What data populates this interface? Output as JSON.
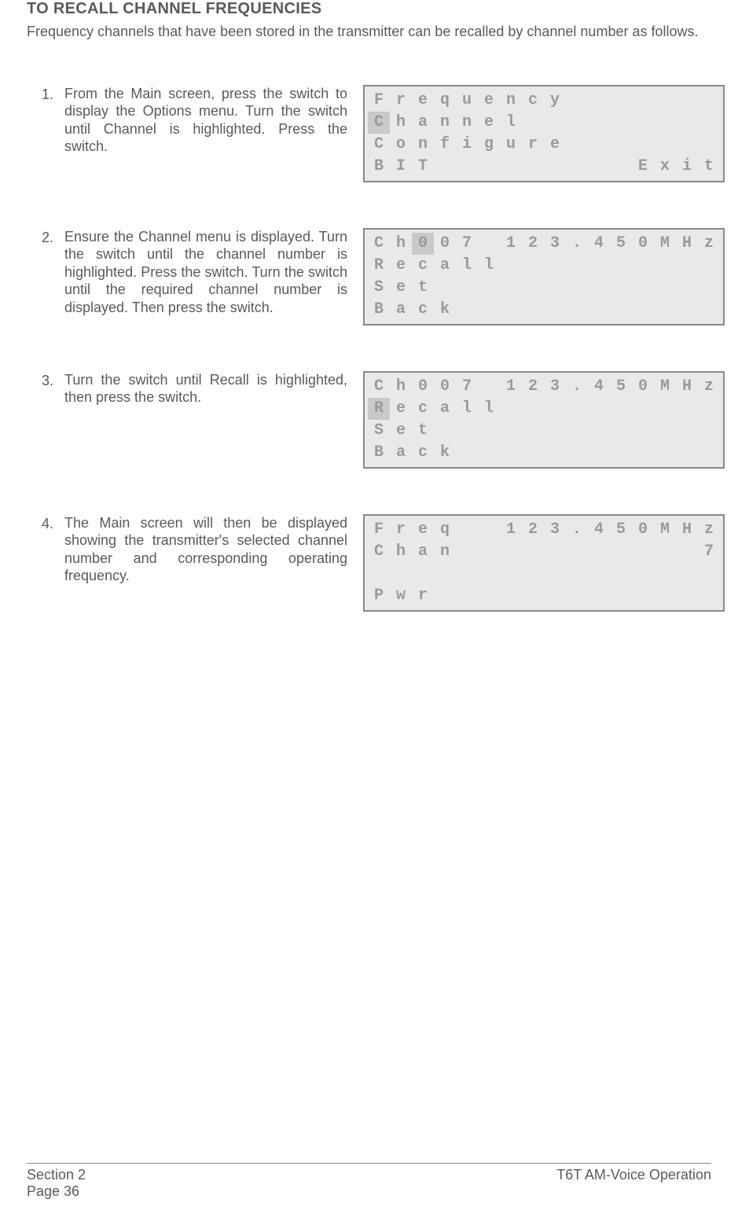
{
  "title": "TO RECALL CHANNEL FREQUENCIES",
  "intro": "Frequency channels that have been stored in the transmitter can be recalled by channel number as follows.",
  "steps": [
    {
      "num": "1.",
      "text": "From the Main screen, press the switch to display the Options menu. Turn the switch until Channel is highlighted. Press the switch.",
      "lcd": [
        {
          "cells": [
            "F",
            "r",
            "e",
            "q",
            "u",
            "e",
            "n",
            "c",
            "y",
            "",
            "",
            "",
            "",
            "",
            "",
            ""
          ],
          "hl": []
        },
        {
          "cells": [
            "C",
            "h",
            "a",
            "n",
            "n",
            "e",
            "l",
            "",
            "",
            "",
            "",
            "",
            "",
            "",
            "",
            ""
          ],
          "hl": [
            0
          ]
        },
        {
          "cells": [
            "C",
            "o",
            "n",
            "f",
            "i",
            "g",
            "u",
            "r",
            "e",
            "",
            "",
            "",
            "",
            "",
            "",
            ""
          ],
          "hl": []
        },
        {
          "cells": [
            "B",
            "I",
            "T",
            "",
            "",
            "",
            "",
            "",
            "",
            "",
            "",
            "",
            "E",
            "x",
            "i",
            "t"
          ],
          "hl": []
        }
      ]
    },
    {
      "num": "2.",
      "text": "Ensure the Channel menu is displayed. Turn the switch until the channel number is highlighted. Press the switch. Turn the switch until the required channel number is displayed. Then press the switch.",
      "lcd": [
        {
          "cells": [
            "C",
            "h",
            "0",
            "0",
            "7",
            "",
            "1",
            "2",
            "3",
            ".",
            "4",
            "5",
            "0",
            "M",
            "H",
            "z"
          ],
          "hl": [
            2
          ]
        },
        {
          "cells": [
            "R",
            "e",
            "c",
            "a",
            "l",
            "l",
            "",
            "",
            "",
            "",
            "",
            "",
            "",
            "",
            "",
            ""
          ],
          "hl": []
        },
        {
          "cells": [
            "S",
            "e",
            "t",
            "",
            "",
            "",
            "",
            "",
            "",
            "",
            "",
            "",
            "",
            "",
            "",
            ""
          ],
          "hl": []
        },
        {
          "cells": [
            "B",
            "a",
            "c",
            "k",
            "",
            "",
            "",
            "",
            "",
            "",
            "",
            "",
            "",
            "",
            "",
            ""
          ],
          "hl": []
        }
      ]
    },
    {
      "num": "3.",
      "text": "Turn the switch until Recall is highlighted, then press the switch.",
      "lcd": [
        {
          "cells": [
            "C",
            "h",
            "0",
            "0",
            "7",
            "",
            "1",
            "2",
            "3",
            ".",
            "4",
            "5",
            "0",
            "M",
            "H",
            "z"
          ],
          "hl": []
        },
        {
          "cells": [
            "R",
            "e",
            "c",
            "a",
            "l",
            "l",
            "",
            "",
            "",
            "",
            "",
            "",
            "",
            "",
            "",
            ""
          ],
          "hl": [
            0
          ]
        },
        {
          "cells": [
            "S",
            "e",
            "t",
            "",
            "",
            "",
            "",
            "",
            "",
            "",
            "",
            "",
            "",
            "",
            "",
            ""
          ],
          "hl": []
        },
        {
          "cells": [
            "B",
            "a",
            "c",
            "k",
            "",
            "",
            "",
            "",
            "",
            "",
            "",
            "",
            "",
            "",
            "",
            ""
          ],
          "hl": []
        }
      ]
    },
    {
      "num": "4.",
      "text": "The Main screen will then be displayed showing the transmitter's selected channel number and corresponding operating frequency.",
      "lcd": [
        {
          "cells": [
            "F",
            "r",
            "e",
            "q",
            "",
            "",
            "1",
            "2",
            "3",
            ".",
            "4",
            "5",
            "0",
            "M",
            "H",
            "z"
          ],
          "hl": []
        },
        {
          "cells": [
            "C",
            "h",
            "a",
            "n",
            "",
            "",
            "",
            "",
            "",
            "",
            "",
            "",
            "",
            "",
            "",
            "7"
          ],
          "hl": []
        },
        {
          "cells": [
            "",
            "",
            "",
            "",
            "",
            "",
            "",
            "",
            "",
            "",
            "",
            "",
            "",
            "",
            "",
            ""
          ],
          "hl": []
        },
        {
          "cells": [
            "P",
            "w",
            "r",
            "",
            "",
            "",
            "",
            "",
            "",
            "",
            "",
            "",
            "",
            "",
            "",
            ""
          ],
          "hl": []
        }
      ]
    }
  ],
  "footer": {
    "left1": "Section 2",
    "left2": "Page 36",
    "right": "T6T AM-Voice Operation"
  }
}
